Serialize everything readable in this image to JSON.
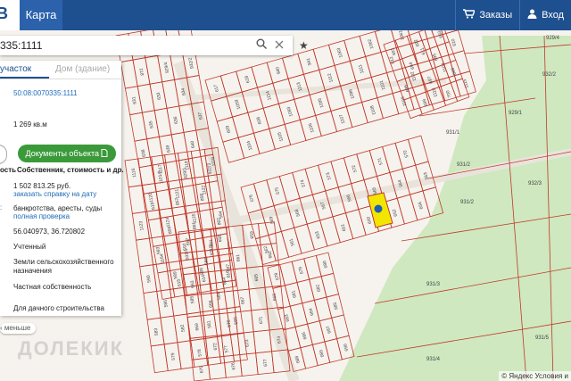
{
  "header": {
    "logo_letter": "В",
    "map_tab": "Карта",
    "orders_label": "Заказы",
    "login_label": "Вход"
  },
  "search": {
    "value": "335:1111",
    "search_icon": "search-icon",
    "clear_icon": "close-icon"
  },
  "panel": {
    "tab_plot": "участок",
    "tab_building": "Дом (здание)",
    "cadastral_number": "50:08:0070335:1111",
    "area": "1 269 кв.м",
    "docs_button": "Документы объекта",
    "docs_left": "ость",
    "docs_caption": "Собственник, стоимость и др.",
    "price": "1 502 813.25 руб.",
    "order_cert": "заказать справку на дату",
    "bankruptcy": "банкротства, аресты, суды",
    "full_check": "полная проверка",
    "coords": "56.040973, 36.720802",
    "status": "Учтенный",
    "category": "Земли сельскохозяйственного назначения",
    "ownership": "Частная собственность",
    "usage": "Для дачного строительства"
  },
  "map": {
    "less_label": "меньше",
    "watermark": "ДОЛЕКИК",
    "copyright": "© Яндекс Условия и",
    "lot_labels": [
      "822",
      "824",
      "823",
      "872",
      "929/4",
      "932/2",
      "631",
      "633",
      "634",
      "635",
      "636",
      "637",
      "638",
      "639",
      "640",
      "1101/2",
      "929/1",
      "932/3",
      "619",
      "857",
      "858",
      "859",
      "861",
      "862",
      "1164",
      "931/1",
      "931/2",
      "615",
      "614",
      "616",
      "617",
      "618",
      "940",
      "941",
      "1063",
      "1062",
      "1061",
      "1060",
      "1059",
      "1114",
      "1113",
      "1112",
      "1111",
      "612",
      "611",
      "610",
      "609",
      "608",
      "1093",
      "1095",
      "1096",
      "1101",
      "1102",
      "1103",
      "1104",
      "1105",
      "1106",
      "1107",
      "1108",
      "1109",
      "1110",
      "1115",
      "1116",
      "1117",
      "1118",
      "1119",
      "1120",
      "1121",
      "1122",
      "1123",
      "1124",
      "1125",
      "594",
      "593",
      "592",
      "591",
      "590",
      "589",
      "588",
      "587",
      "586",
      "585",
      "584",
      "583",
      "582",
      "581",
      "580",
      "579",
      "578",
      "577",
      "576",
      "575",
      "574",
      "573",
      "572",
      "571",
      "570",
      "569",
      "568",
      "567",
      "566",
      "565",
      "564",
      "563",
      "562",
      "561",
      "653",
      "651",
      "650",
      "652",
      "656",
      "657",
      "658",
      "659",
      "660",
      "661",
      "662",
      "663",
      "664",
      "665",
      "666",
      "667",
      "668",
      "669",
      "670",
      "671",
      "672",
      "673",
      "674",
      "675",
      "676",
      "677",
      "678",
      "679",
      "680",
      "681",
      "682",
      "683",
      "684",
      "685",
      "686",
      "687",
      "688",
      "689",
      "690",
      "691",
      "692",
      "693",
      "694",
      "695",
      "696",
      "697",
      "698",
      "699",
      "700",
      "931/3",
      "931/4",
      "931/5",
      "1102/1",
      "1102/4",
      "621",
      "622",
      "623",
      "624",
      "625",
      "626",
      "627",
      "628",
      "629",
      "630"
    ],
    "colors": {
      "parcel": "#c0392b",
      "forest": "#cfe8bf",
      "road": "#e8e4dc",
      "selected": "#f2e600",
      "marker": "#1e5fb4"
    }
  }
}
